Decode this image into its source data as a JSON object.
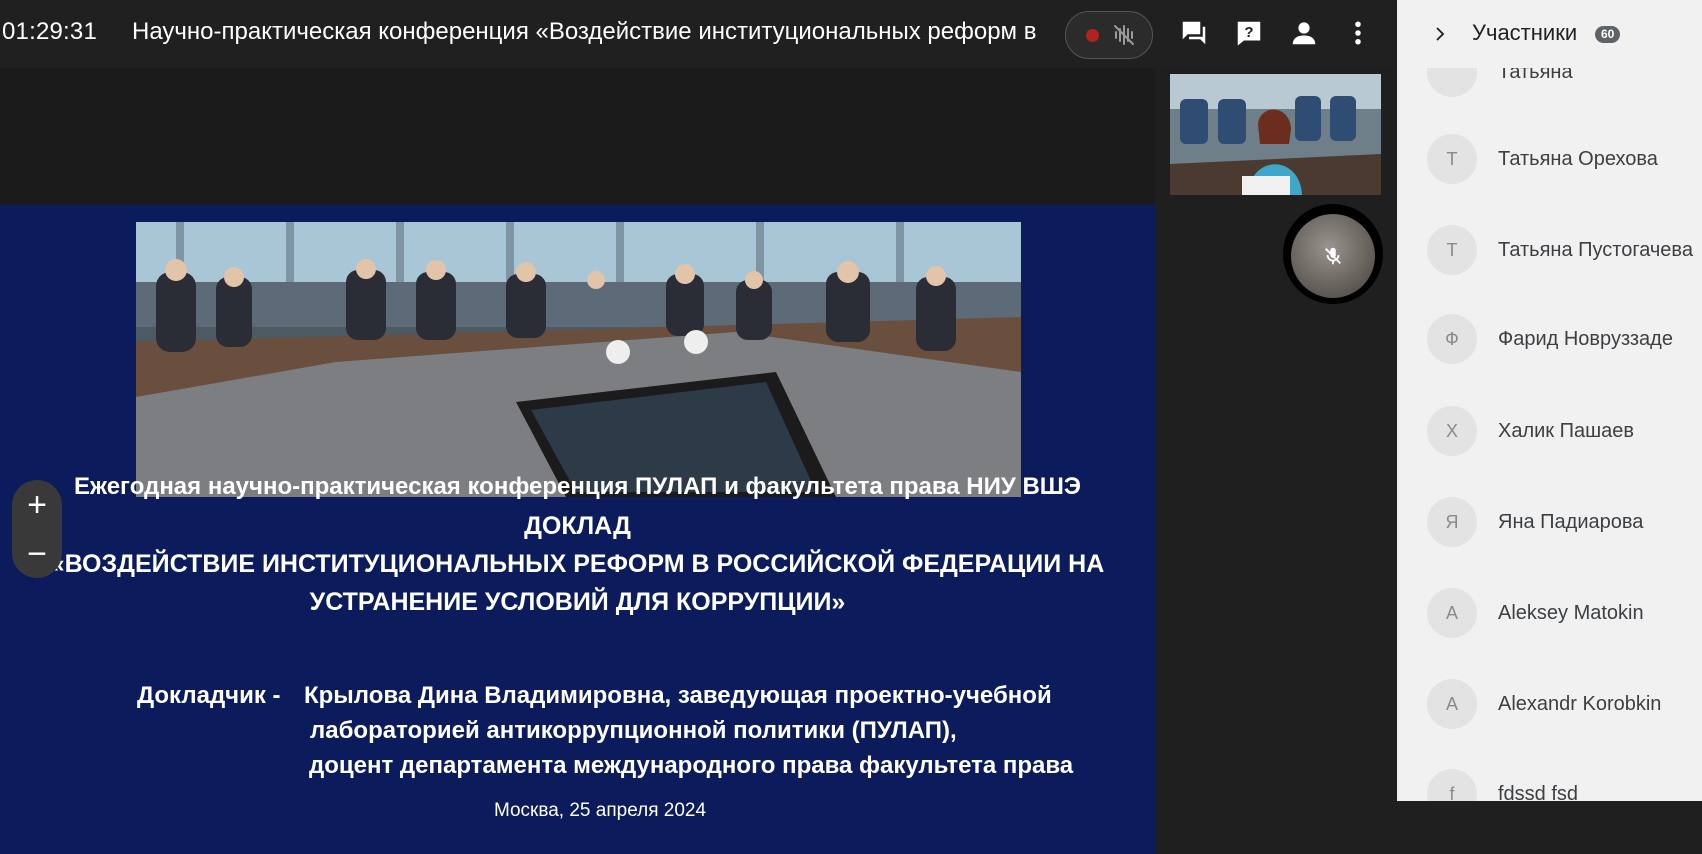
{
  "topbar": {
    "timer": "01:29:31",
    "title": "Научно-практическая конференция «Воздействие институциональных реформ в Российской Федерации на устранение условий для коррупции»",
    "icons": [
      "record-indicator",
      "audio-wave-muted",
      "chat",
      "question",
      "person",
      "more-vert"
    ]
  },
  "slide": {
    "line1": "Ежегодная научно-практическая конференция  ПУЛАП и факультета права НИУ ВШЭ",
    "line2": "ДОКЛАД",
    "line3": "«ВОЗДЕЙСТВИЕ ИНСТИТУЦИОНАЛЬНЫХ РЕФОРМ В РОССИЙСКОЙ ФЕДЕРАЦИИ НА",
    "line4": "УСТРАНЕНИЕ УСЛОВИЙ ДЛЯ КОРРУПЦИИ»",
    "speaker_label": "Докладчик  -",
    "speaker_line1": "Крылова Дина Владимировна, заведующая проектно-учебной",
    "speaker_line2": "лабораторией антикоррупционной политики (ПУЛАП),",
    "speaker_line3": "доцент департамента международного права факультета права",
    "place_date": "Москва, 25 апреля 2024",
    "zoom_in": "+",
    "zoom_out": "−",
    "colors": {
      "background": "#0b1b5c",
      "text": "#ffffff"
    }
  },
  "participants_panel": {
    "title": "Участники",
    "count": "60",
    "items": [
      {
        "initial": "",
        "name": "Татьяна"
      },
      {
        "initial": "Т",
        "name": "Татьяна Орехова"
      },
      {
        "initial": "Т",
        "name": "Татьяна Пустогачева"
      },
      {
        "initial": "Ф",
        "name": "Фарид Новруззаде"
      },
      {
        "initial": "Х",
        "name": "Халик Пашаев"
      },
      {
        "initial": "Я",
        "name": "Яна Падиарова"
      },
      {
        "initial": "A",
        "name": "Aleksey Matokin"
      },
      {
        "initial": "A",
        "name": "Alexandr Korobkin"
      },
      {
        "initial": "f",
        "name": "fdssd fsd"
      }
    ]
  }
}
